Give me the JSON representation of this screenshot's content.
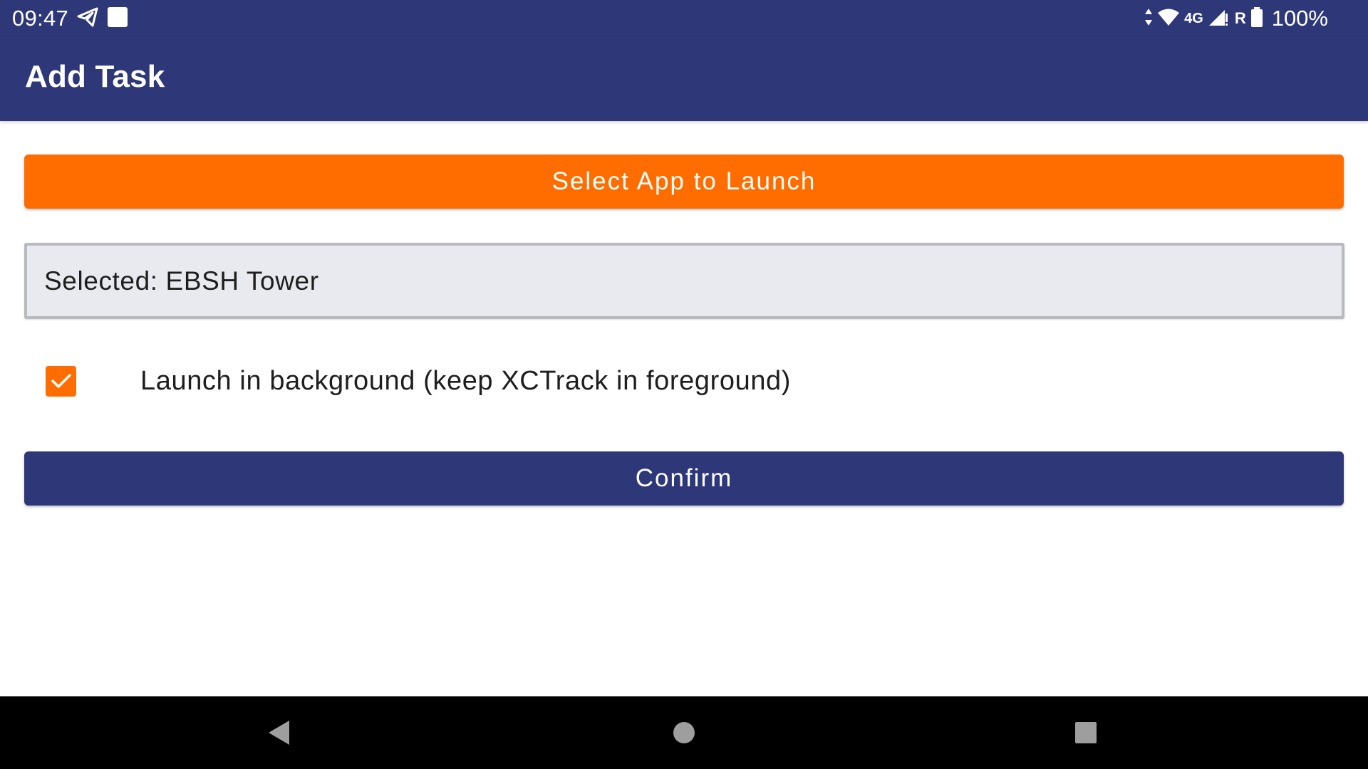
{
  "status_bar": {
    "time": "09:47",
    "network_type": "4G",
    "roaming": "R",
    "battery_percent": "100%",
    "icons": [
      "telegram-icon",
      "notification-square-icon",
      "data-arrows-icon",
      "wifi-icon",
      "signal-icon",
      "battery-icon"
    ]
  },
  "app_bar": {
    "title": "Add Task"
  },
  "main": {
    "select_app_button_label": "Select App to Launch",
    "selected_text": "Selected: EBSH Tower",
    "background_checkbox": {
      "checked": true,
      "label": "Launch in background (keep XCTrack in foreground)"
    },
    "confirm_button_label": "Confirm"
  },
  "nav_bar": {
    "buttons": [
      "back-icon",
      "home-icon",
      "recents-icon"
    ]
  },
  "colors": {
    "primary": "#2e3879",
    "accent": "#ff6d00",
    "field_background": "#e9eaef",
    "nav_background": "#000000"
  }
}
